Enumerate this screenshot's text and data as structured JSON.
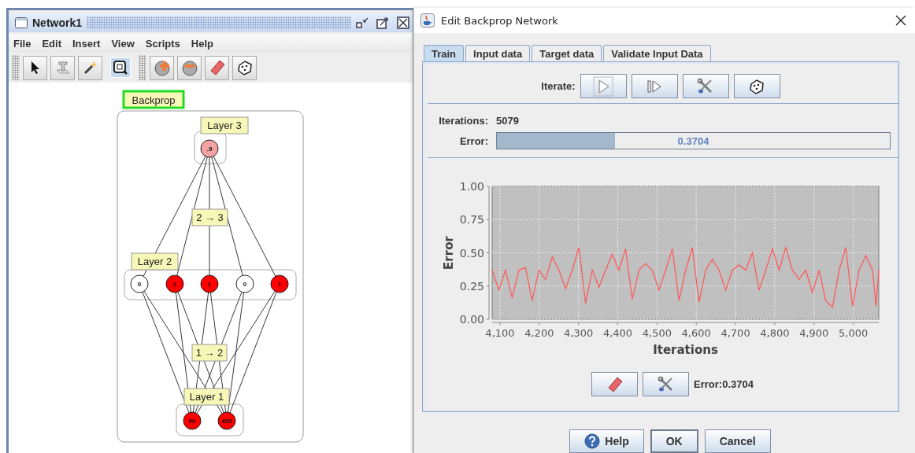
{
  "network_window": {
    "title": "Network1",
    "menu": [
      "File",
      "Edit",
      "Insert",
      "View",
      "Scripts",
      "Help"
    ],
    "tools": [
      {
        "kind": "pointer",
        "selected": false
      },
      {
        "kind": "text",
        "selected": false
      },
      {
        "kind": "wand",
        "selected": false
      },
      {
        "kind": "zoom",
        "selected": true
      },
      {
        "kind": "add",
        "selected": false
      },
      {
        "kind": "remove",
        "selected": false
      },
      {
        "kind": "eraser",
        "selected": false
      },
      {
        "kind": "dice",
        "selected": false
      }
    ],
    "network": {
      "group_label": "Backprop",
      "layers": [
        {
          "label": "Layer 3",
          "neurons": [
            {
              "value": ".9",
              "color": "#f4a3a3"
            }
          ]
        },
        {
          "label": "Layer 2",
          "neurons": [
            {
              "value": "0",
              "color": "#ffffff"
            },
            {
              "value": "1",
              "color": "#ff0000"
            },
            {
              "value": "1",
              "color": "#ff0000"
            },
            {
              "value": "0",
              "color": "#ffffff"
            },
            {
              "value": "1",
              "color": "#ff0000"
            }
          ]
        },
        {
          "label": "Layer 1",
          "neurons": [
            {
              "value": "96",
              "color": "#ff0000"
            },
            {
              "value": "400",
              "color": "#ff0000"
            }
          ]
        }
      ],
      "weights": [
        {
          "label": "2 → 3"
        },
        {
          "label": "1 → 2"
        }
      ]
    }
  },
  "dialog": {
    "title": "Edit Backprop Network",
    "tabs": [
      {
        "label": "Train",
        "selected": true
      },
      {
        "label": "Input data",
        "selected": false
      },
      {
        "label": "Target data",
        "selected": false
      },
      {
        "label": "Validate Input Data",
        "selected": false
      }
    ],
    "iterate_label": "Iterate:",
    "iterate_buttons": [
      {
        "kind": "play"
      },
      {
        "kind": "step"
      },
      {
        "kind": "tools"
      },
      {
        "kind": "dice"
      }
    ],
    "iterations_label": "Iterations:",
    "iterations_value": "5079",
    "error_label": "Error:",
    "error_bar": {
      "level": 0.3,
      "reading": "0.3704"
    },
    "chart_data": {
      "type": "line",
      "grid": true,
      "xlabel": "Iterations",
      "ylabel": "Error",
      "xlim": [
        4080,
        5065
      ],
      "ylim": [
        0,
        1
      ],
      "xticks": [
        {
          "value": 4100,
          "label": "4,100"
        },
        {
          "value": 4200,
          "label": "4,200"
        },
        {
          "value": 4300,
          "label": "4,300"
        },
        {
          "value": 4400,
          "label": "4,400"
        },
        {
          "value": 4500,
          "label": "4,500"
        },
        {
          "value": 4600,
          "label": "4,600"
        },
        {
          "value": 4700,
          "label": "4,700"
        },
        {
          "value": 4800,
          "label": "4,800"
        },
        {
          "value": 4900,
          "label": "4,900"
        },
        {
          "value": 5000,
          "label": "5,000"
        }
      ],
      "yticks": [
        {
          "value": 0,
          "label": "0.00"
        },
        {
          "value": 0.25,
          "label": "0.25"
        },
        {
          "value": 0.5,
          "label": "0.50"
        },
        {
          "value": 0.75,
          "label": "0.75"
        },
        {
          "value": 1,
          "label": "1.00"
        }
      ],
      "x": [
        4080,
        4097,
        4114,
        4131,
        4148,
        4165,
        4182,
        4199,
        4216,
        4233,
        4250,
        4267,
        4284,
        4301,
        4318,
        4335,
        4352,
        4369,
        4386,
        4403,
        4420,
        4437,
        4454,
        4471,
        4488,
        4505,
        4522,
        4539,
        4556,
        4573,
        4590,
        4607,
        4624,
        4641,
        4658,
        4675,
        4692,
        4709,
        4726,
        4743,
        4760,
        4777,
        4794,
        4811,
        4828,
        4845,
        4862,
        4879,
        4896,
        4913,
        4930,
        4947,
        4964,
        4981,
        4998,
        5015,
        5032,
        5049,
        5058,
        5065
      ],
      "series": [
        {
          "color": "#ff5555",
          "values": [
            0.37,
            0.22,
            0.37,
            0.16,
            0.37,
            0.39,
            0.14,
            0.37,
            0.3,
            0.47,
            0.37,
            0.23,
            0.37,
            0.54,
            0.12,
            0.37,
            0.24,
            0.37,
            0.49,
            0.37,
            0.53,
            0.15,
            0.37,
            0.42,
            0.37,
            0.22,
            0.37,
            0.53,
            0.14,
            0.37,
            0.54,
            0.13,
            0.37,
            0.45,
            0.37,
            0.22,
            0.37,
            0.41,
            0.37,
            0.5,
            0.22,
            0.37,
            0.53,
            0.37,
            0.54,
            0.37,
            0.3,
            0.37,
            0.2,
            0.37,
            0.14,
            0.09,
            0.37,
            0.54,
            0.1,
            0.37,
            0.48,
            0.37,
            0.1,
            0.37
          ]
        }
      ]
    },
    "bottom_buttons": [
      {
        "kind": "eraser"
      },
      {
        "kind": "tools"
      }
    ],
    "error_readout": "Error:0.3704",
    "buttons": [
      {
        "label": "Help",
        "kind": "help",
        "default": false
      },
      {
        "label": "OK",
        "kind": "plain",
        "default": true
      },
      {
        "label": "Cancel",
        "kind": "plain",
        "default": false
      }
    ]
  }
}
